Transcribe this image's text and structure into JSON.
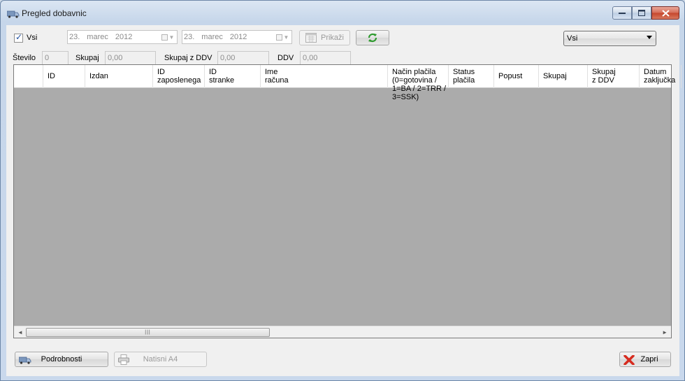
{
  "window": {
    "title": "Pregled dobavnic"
  },
  "filters": {
    "all_label": "Vsi",
    "all_checked": true,
    "date_from": {
      "day": "23.",
      "month": "marec",
      "year": "2012"
    },
    "date_to": {
      "day": "23.",
      "month": "marec",
      "year": "2012"
    },
    "show_label": "Prikaži",
    "type_select": "Vsi"
  },
  "totals": {
    "count_label": "Število",
    "count_value": "0",
    "sum_label": "Skupaj",
    "sum_value": "0,00",
    "sum_vat_label": "Skupaj z DDV",
    "sum_vat_value": "0,00",
    "vat_label": "DDV",
    "vat_value": "0,00"
  },
  "grid": {
    "columns": [
      {
        "line1": "ID",
        "line2": ""
      },
      {
        "line1": "Izdan",
        "line2": ""
      },
      {
        "line1": "ID",
        "line2": "zaposlenega"
      },
      {
        "line1": "ID",
        "line2": "stranke"
      },
      {
        "line1": "Ime",
        "line2": "računa"
      },
      {
        "line1": "Način plačila (0=gotovina /",
        "line2": "1=BA / 2=TRR / 3=SSK)"
      },
      {
        "line1": "Status",
        "line2": "plačila"
      },
      {
        "line1": "Popust",
        "line2": ""
      },
      {
        "line1": "Skupaj",
        "line2": ""
      },
      {
        "line1": "Skupaj",
        "line2": "z DDV"
      },
      {
        "line1": "Datum",
        "line2": "zaključka"
      }
    ],
    "rows": []
  },
  "actions": {
    "details_label": "Podrobnosti",
    "print_label": "Natisni A4",
    "close_label": "Zapri"
  },
  "colors": {
    "grid_background": "#ababab",
    "title_bar": "#c6d6ea"
  }
}
